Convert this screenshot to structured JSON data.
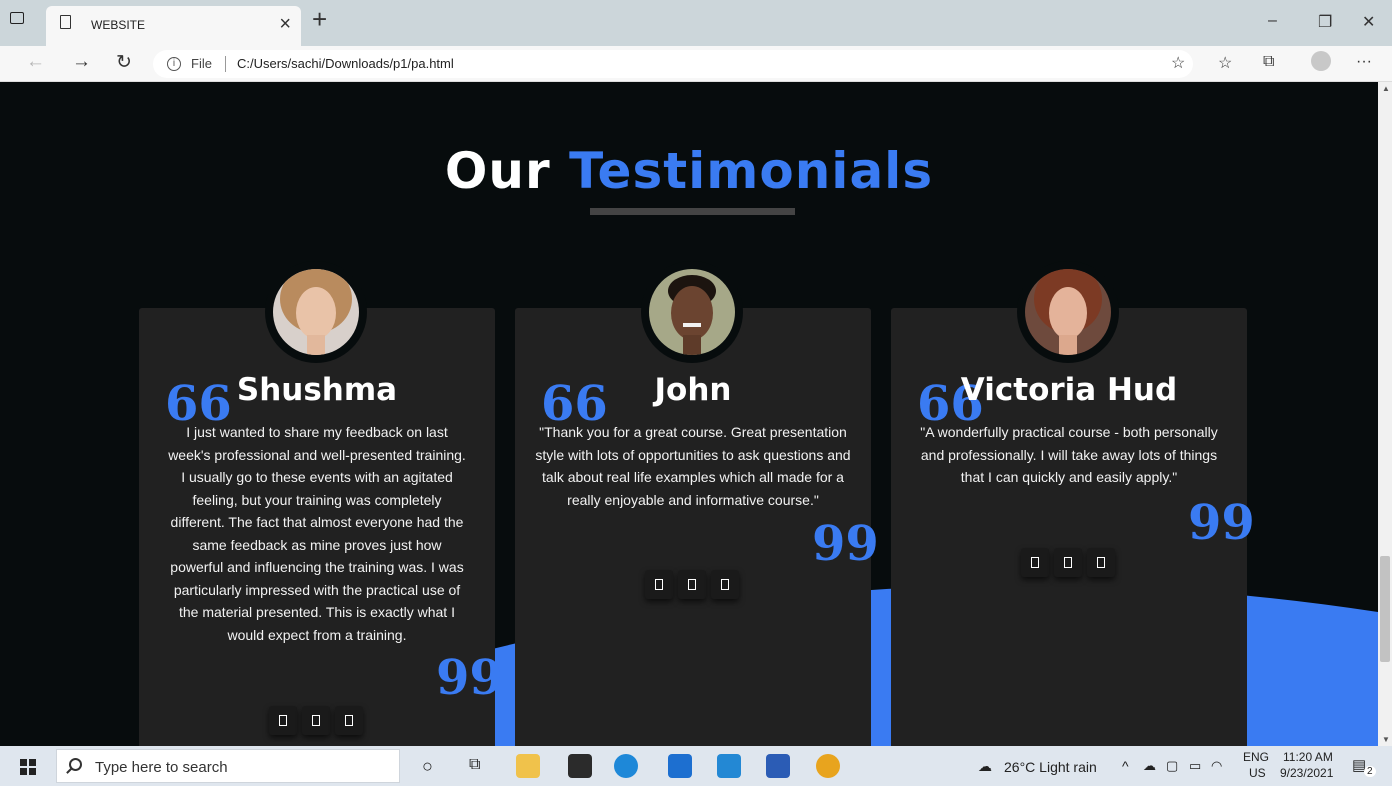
{
  "browser": {
    "tab_title": "WEBSITE",
    "tab_close": "×",
    "new_tab": "+",
    "file_label": "File",
    "url": "C:/Users/sachi/Downloads/p1/pa.html",
    "window_controls": [
      "–",
      "❐",
      "✕"
    ],
    "nav_icons": [
      "back-arrow-icon",
      "forward-arrow-icon",
      "refresh-icon"
    ],
    "toolbar_icons": [
      "add-favorite-icon",
      "favorites-icon",
      "collections-icon",
      "profile-icon",
      "more-icon"
    ],
    "more_glyph": "···"
  },
  "page": {
    "title_white": "Our",
    "title_blue": "Testimonials",
    "accent_color": "#3a7bf2",
    "background": "#070c0d",
    "card_color": "#212121",
    "testimonials": [
      {
        "name": "Shushma",
        "quote": "I just wanted to share my feedback on last week's professional and well-presented training. I usually go to these events with an agitated feeling, but your training was completely different. The fact that almost everyone had the same feedback as mine proves just how powerful and influencing the training was. I was particularly impressed with the practical use of the material presented. This is exactly what I would expect from a training.",
        "social_icon_count": 3
      },
      {
        "name": "John",
        "quote": "\"Thank you for a great course. Great presentation style with lots of opportunities to ask questions and talk about real life examples which all made for a really enjoyable and informative course.\"",
        "social_icon_count": 3
      },
      {
        "name": "Victoria Hud",
        "quote": "\"A wonderfully practical course - both personally and professionally. I will take away lots of things that I can quickly and easily apply.\"",
        "social_icon_count": 3
      }
    ],
    "quote_open": "66",
    "quote_close": "99"
  },
  "taskbar": {
    "search_placeholder": "Type here to search",
    "weather": "26°C  Light rain",
    "language": "ENG",
    "region": "US",
    "time": "11:20 AM",
    "date": "9/23/2021",
    "notification_count": "2"
  }
}
